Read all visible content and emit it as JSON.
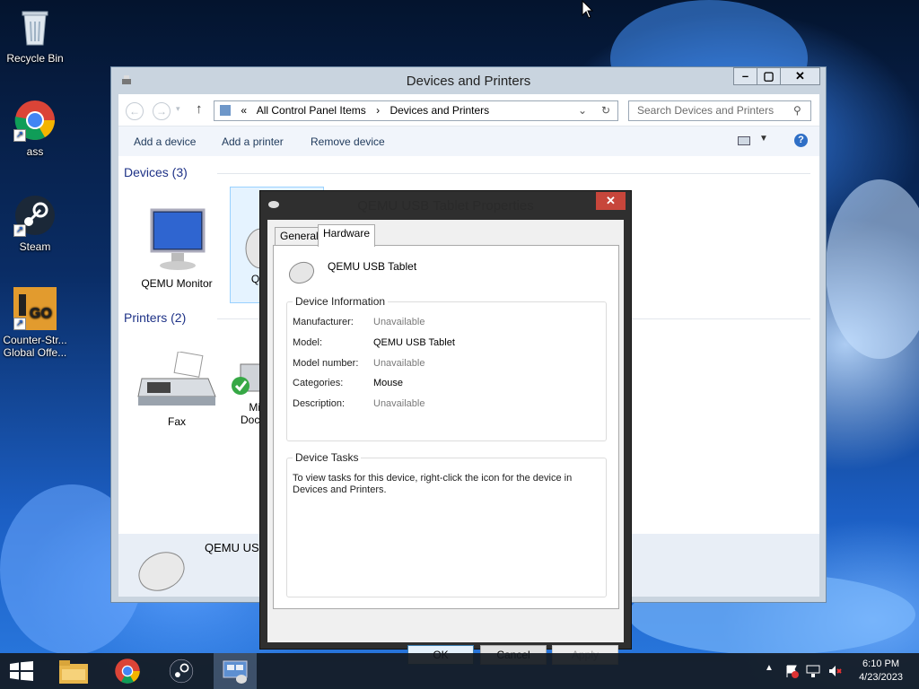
{
  "desktop": {
    "icons": [
      {
        "name": "recycle-bin",
        "label": "Recycle Bin"
      },
      {
        "name": "chrome",
        "label": "ass"
      },
      {
        "name": "steam",
        "label": "Steam"
      },
      {
        "name": "csgo",
        "label": "Counter-Str... Global Offe..."
      }
    ]
  },
  "explorer": {
    "title": "Devices and Printers",
    "breadcrumb": {
      "prefix": "«",
      "items": [
        "All Control Panel Items",
        "›",
        "Devices and Printers"
      ]
    },
    "search_placeholder": "Search Devices and Printers",
    "toolbar": {
      "add_device": "Add a device",
      "add_printer": "Add a printer",
      "remove_device": "Remove device"
    },
    "devices_header": "Devices (3)",
    "printers_header": "Printers (2)",
    "devices": [
      {
        "label": "QEMU Monitor"
      },
      {
        "label": "QE"
      }
    ],
    "printers": [
      {
        "label": "Fax"
      },
      {
        "label": "Mic",
        "label2": "Docu"
      }
    ],
    "detail_label": "QEMU USB"
  },
  "dialog": {
    "title": "QEMU USB Tablet Properties",
    "tabs": [
      "General",
      "Hardware"
    ],
    "active_tab": "Hardware",
    "device_name": "QEMU USB Tablet",
    "info_legend": "Device Information",
    "info_rows": [
      {
        "key": "Manufacturer:",
        "value": "Unavailable",
        "unavailable": true
      },
      {
        "key": "Model:",
        "value": "QEMU USB Tablet",
        "unavailable": false
      },
      {
        "key": "Model number:",
        "value": "Unavailable",
        "unavailable": true
      },
      {
        "key": "Categories:",
        "value": "Mouse",
        "unavailable": false
      },
      {
        "key": "Description:",
        "value": "Unavailable",
        "unavailable": true
      }
    ],
    "tasks_legend": "Device Tasks",
    "tasks_text_1": "To view tasks for this device, right-click the icon for the device in",
    "tasks_text_2": "Devices and Printers.",
    "ok": "OK",
    "cancel": "Cancel",
    "apply": "Apply"
  },
  "taskbar": {
    "time": "6:10 PM",
    "date": "4/23/2023"
  }
}
